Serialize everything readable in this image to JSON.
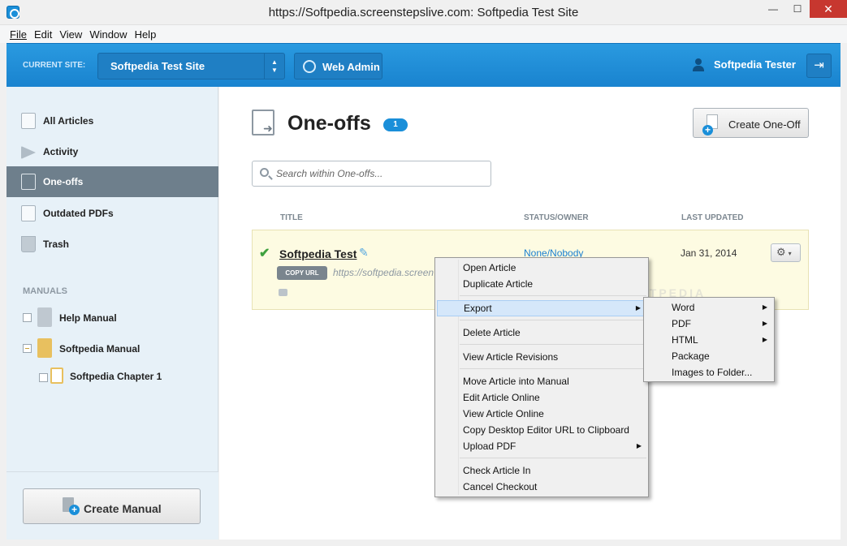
{
  "window": {
    "title": "https://Softpedia.screenstepslive.com: Softpedia Test Site",
    "controls": {
      "minimize": "—",
      "maximize": "☐",
      "close": "✕"
    }
  },
  "menubar": {
    "items": [
      "File",
      "Edit",
      "View",
      "Window",
      "Help"
    ]
  },
  "header": {
    "current_site_label": "CURRENT SITE:",
    "site_value": "Softpedia Test Site",
    "web_admin_label": "Web Admin",
    "user_name": "Softpedia Tester",
    "logout_icon": "logout-icon"
  },
  "sidebar": {
    "nav": [
      {
        "label": "All Articles",
        "icon": "document-icon"
      },
      {
        "label": "Activity",
        "icon": "paper-plane-icon"
      },
      {
        "label": "One-offs",
        "icon": "one-off-icon"
      },
      {
        "label": "Outdated PDFs",
        "icon": "clock-document-icon"
      },
      {
        "label": "Trash",
        "icon": "trash-icon"
      }
    ],
    "manuals_heading": "MANUALS",
    "manuals": [
      {
        "label": "Help Manual"
      },
      {
        "label": "Softpedia Manual"
      },
      {
        "label": "Softpedia Chapter 1"
      }
    ],
    "create_manual_label": "Create Manual"
  },
  "main": {
    "title": "One-offs",
    "count": "1",
    "create_button_label": "Create One-Off",
    "search_placeholder": "Search within One-offs...",
    "columns": {
      "title": "TITLE",
      "status": "STATUS/OWNER",
      "updated": "LAST UPDATED"
    },
    "article": {
      "title": "Softpedia Test",
      "copy_url_label": "COPY URL",
      "url": "https://softpedia.screen",
      "status": "None/Nobody",
      "last_updated": "Jan 31, 2014",
      "gear_symbol": "⚙",
      "gear_caret": "▾"
    }
  },
  "context_menu": {
    "items": [
      "Open Article",
      "Duplicate Article",
      "Export",
      "Delete Article",
      "View Article Revisions",
      "Move Article into Manual",
      "Edit Article Online",
      "View Article Online",
      "Copy Desktop Editor URL to Clipboard",
      "Upload PDF",
      "Check Article In",
      "Cancel Checkout"
    ],
    "submenu_arrow": "▶"
  },
  "export_submenu": {
    "items": [
      "Word",
      "PDF",
      "HTML",
      "Package",
      "Images to Folder..."
    ]
  },
  "watermark": "SOFTPEDIA"
}
